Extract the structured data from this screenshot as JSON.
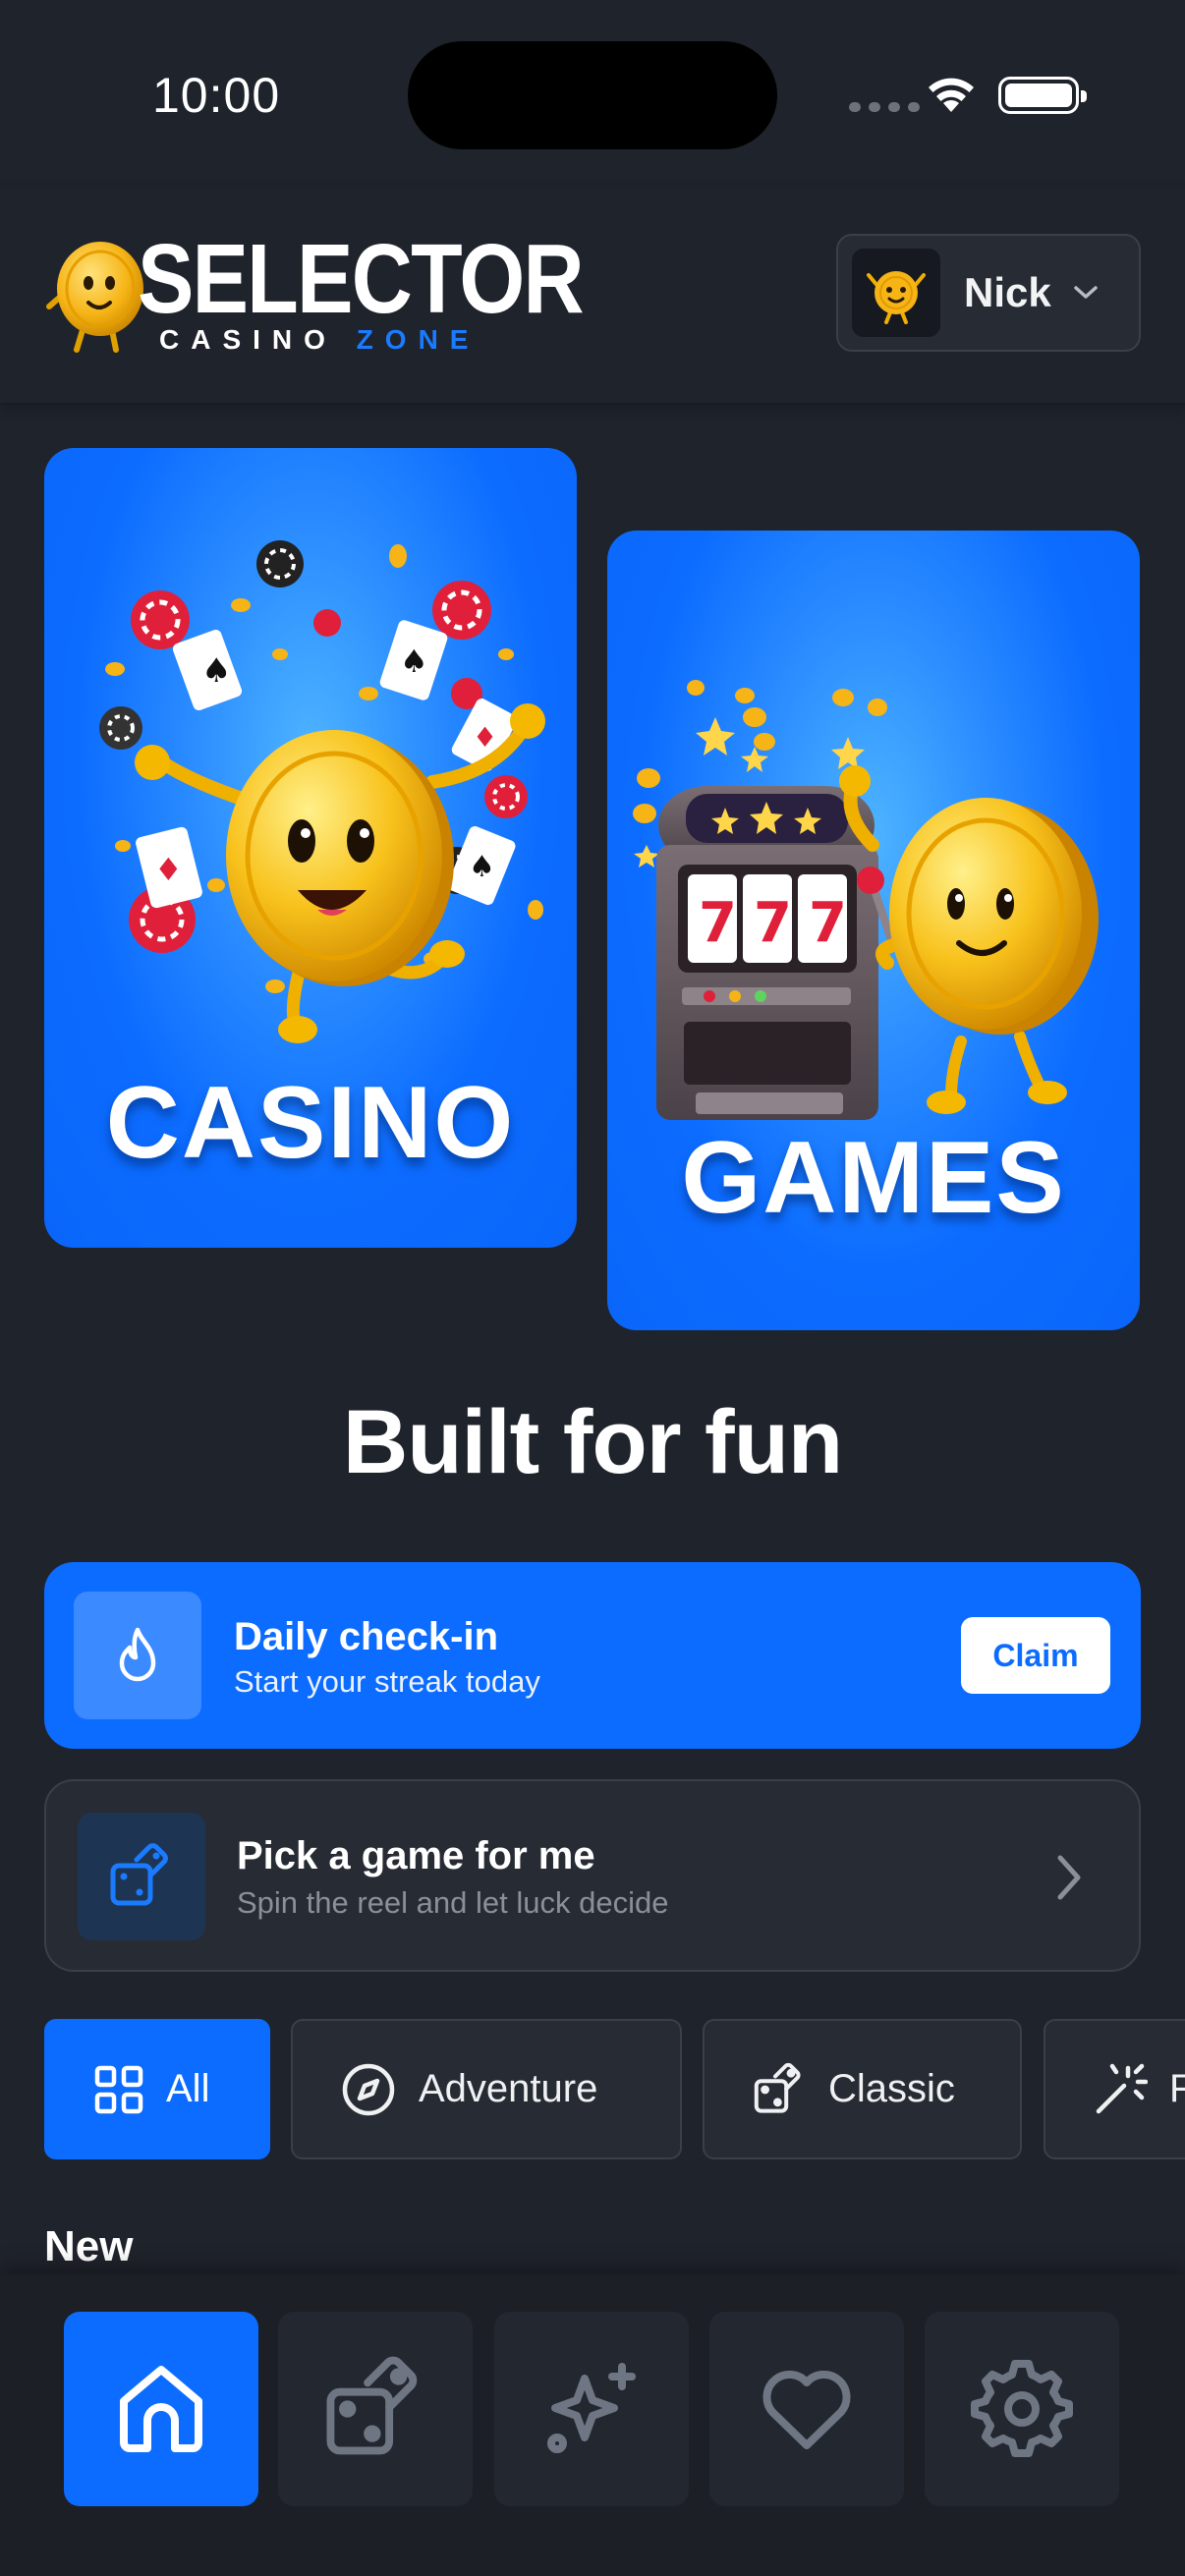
{
  "status_bar": {
    "time": "10:00"
  },
  "header": {
    "logo_title": "SELECTOR",
    "logo_sub_a": "CASINO ",
    "logo_sub_b": "ZONE",
    "user_name": "Nick"
  },
  "promos": {
    "casino_label": "CASINO",
    "games_label": "GAMES"
  },
  "section_title": "Built for fun",
  "checkin": {
    "title": "Daily check-in",
    "subtitle": "Start your streak today",
    "claim_label": "Claim",
    "icon": "flame-icon"
  },
  "pick": {
    "title": "Pick a game for me",
    "subtitle": "Spin the reel and let luck decide",
    "icon": "dice-icon"
  },
  "chips": [
    {
      "label": "All",
      "icon": "grid-icon",
      "active": true
    },
    {
      "label": "Adventure",
      "icon": "compass-icon",
      "active": false
    },
    {
      "label": "Classic",
      "icon": "dice-icon",
      "active": false
    },
    {
      "label": "Fun",
      "icon": "magic-wand-icon",
      "active": false
    }
  ],
  "new_label": "New",
  "bottom_nav": [
    {
      "icon": "home-icon",
      "active": true
    },
    {
      "icon": "dice-icon",
      "active": false
    },
    {
      "icon": "sparkles-icon",
      "active": false
    },
    {
      "icon": "heart-icon",
      "active": false
    },
    {
      "icon": "gear-icon",
      "active": false
    }
  ],
  "colors": {
    "background": "#1f232b",
    "accent": "#0c6cff",
    "card": "#272b33",
    "muted_text": "#8a9099"
  }
}
